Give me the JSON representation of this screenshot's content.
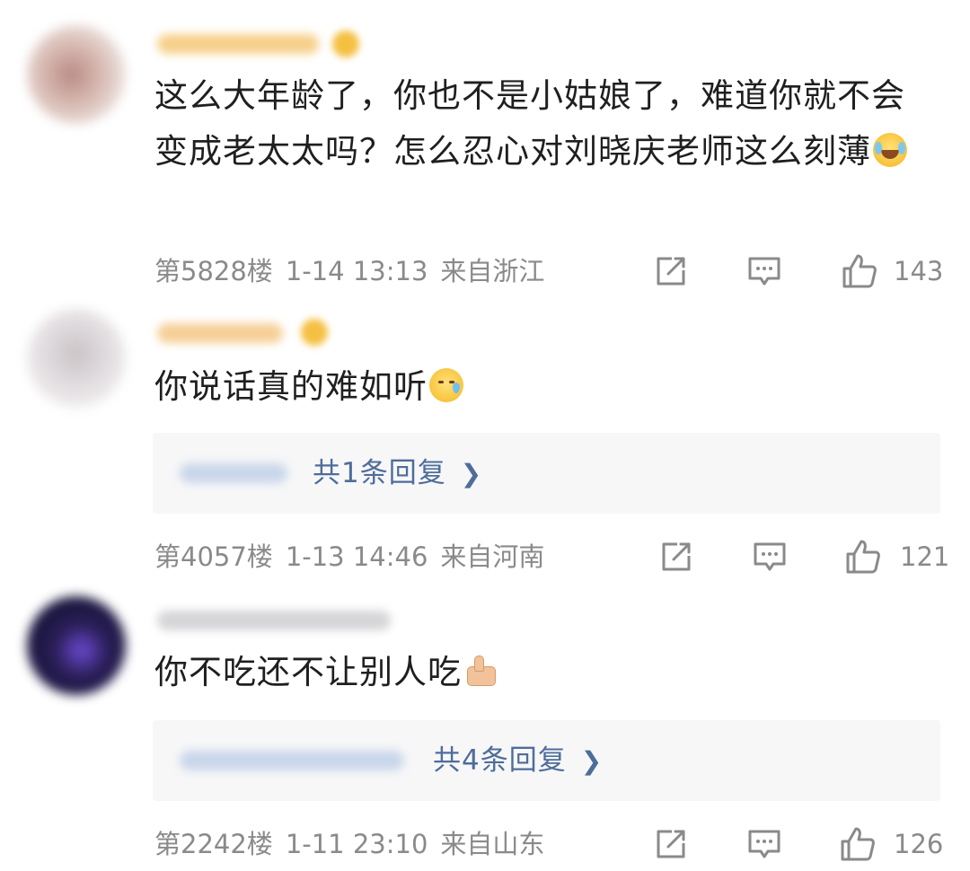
{
  "comments": [
    {
      "text": "这么大年龄了，你也不是小姑娘了，难道你就不会变成老太太吗？怎么忍心对刘晓庆老师这么刻薄",
      "emoji": "laughing-crying-icon",
      "floor": "第5828楼",
      "date": "1-14 13:13",
      "location": "来自浙江",
      "likes": "143"
    },
    {
      "text": "你说话真的难如听",
      "emoji": "sweat-face-icon",
      "reply_link": "共1条回复",
      "floor": "第4057楼",
      "date": "1-13 14:46",
      "location": "来自河南",
      "likes": "121"
    },
    {
      "text": "你不吃还不让别人吃",
      "emoji": "thumbs-up-icon",
      "reply_link": "共4条回复",
      "floor": "第2242楼",
      "date": "1-11 23:10",
      "location": "来自山东",
      "likes": "126"
    }
  ],
  "colors": {
    "link": "#4e6d9a",
    "meta": "#8a8a8a",
    "reply_bg": "#f7f7f8",
    "badge": "#f5c042"
  }
}
